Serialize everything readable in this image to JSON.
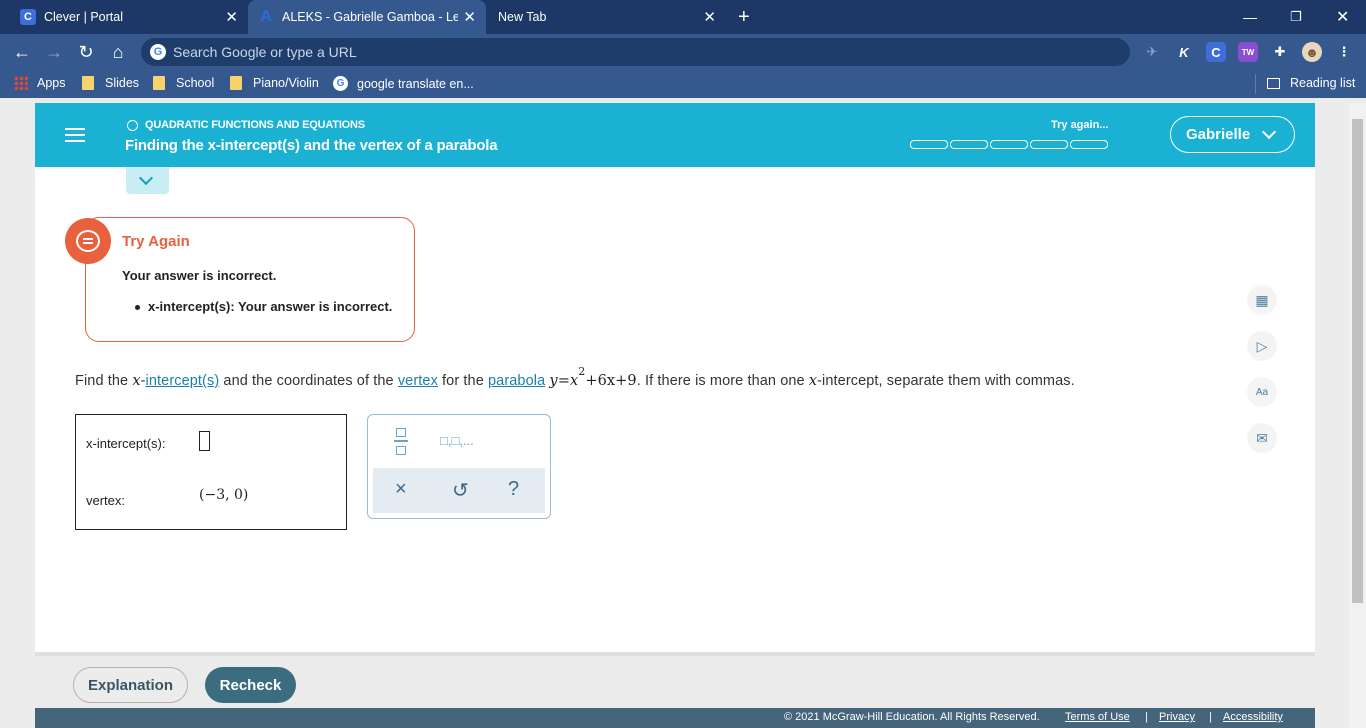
{
  "browser": {
    "tabs": [
      {
        "label": "Clever | Portal",
        "favicon": "C"
      },
      {
        "label": "ALEKS - Gabrielle Gamboa - Lear",
        "favicon": "A"
      },
      {
        "label": "New Tab"
      }
    ],
    "omnibox_placeholder": "Search Google or type a URL",
    "extensions": [
      "K",
      "C",
      "TW"
    ],
    "bookmarks": [
      "Apps",
      "Slides",
      "School",
      "Piano/Violin",
      "google translate en..."
    ],
    "reading_list": "Reading list",
    "accent": "#35598f"
  },
  "header": {
    "topic": "QUADRATIC FUNCTIONS AND EQUATIONS",
    "lesson": "Finding the x-intercept(s) and the vertex of a parabola",
    "status": "Try again...",
    "progress_segments": 5,
    "user": "Gabrielle",
    "color": "#1ab1d3"
  },
  "feedback": {
    "title": "Try Again",
    "message": "Your answer is incorrect.",
    "items": [
      "x-intercept(s): Your answer is incorrect."
    ],
    "color": "#e9603e"
  },
  "question": {
    "p1": "Find the ",
    "x": "x",
    "p2": "-",
    "link_intercepts": "intercept(s)",
    "p3": " and the coordinates of the ",
    "link_vertex": "vertex",
    "p4": " for the ",
    "link_parabola": "parabola",
    "eq_y": "y",
    "eq_eq": "=",
    "eq_x": "x",
    "eq_exp": "2",
    "eq_rest": "+6x+9",
    "p5": ". If there is more than one ",
    "p6": "-intercept, separate them with commas."
  },
  "answer": {
    "xint_label": "x-intercept(s):",
    "xint_value": "",
    "vertex_label": "vertex:",
    "vertex_value": "(−3, 0)"
  },
  "palette": {
    "sequence_label": "□,□,...",
    "clear": "×",
    "undo": "↺",
    "help": "?"
  },
  "side_icons": [
    "calculator-icon",
    "video-icon",
    "dictionary-icon",
    "message-icon"
  ],
  "footer": {
    "explanation": "Explanation",
    "recheck": "Recheck",
    "copyright": "© 2021 McGraw-Hill Education. All Rights Reserved.",
    "terms": "Terms of Use",
    "privacy": "Privacy",
    "accessibility": "Accessibility",
    "separator": "|"
  }
}
